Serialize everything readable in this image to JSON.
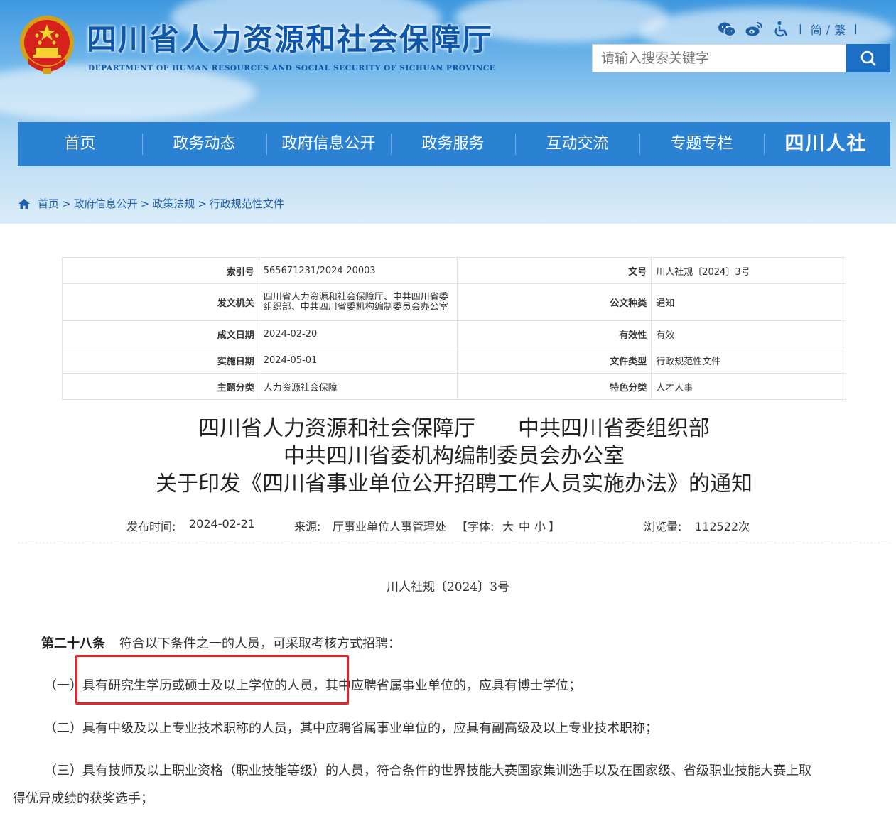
{
  "site": {
    "title": "四川省人力资源和社会保障厅",
    "subtitle": "DEPARTMENT OF HUMAN RESOURCES AND SOCIAL SECURITY OF SICHUAN PROVINCE",
    "tools": {
      "icons": [
        "wechat-icon",
        "weibo-icon",
        "accessibility-icon"
      ],
      "separator": "|",
      "lang_simplified": "简",
      "lang_divider": "/",
      "lang_traditional": "繁"
    },
    "search": {
      "placeholder": "请输入搜索关键字"
    }
  },
  "nav": {
    "items": [
      "首页",
      "政务动态",
      "政府信息公开",
      "政务服务",
      "互动交流",
      "专题专栏"
    ],
    "brand": "四川人社"
  },
  "breadcrumb": {
    "items": [
      "首页",
      "政府信息公开",
      "政策法规",
      "行政规范性文件"
    ],
    "separator": ">"
  },
  "meta": {
    "rows": [
      {
        "label1": "索引号",
        "value1": "565671231/2024-20003",
        "label2": "文号",
        "value2": "川人社规〔2024〕3号"
      },
      {
        "label1": "发文机关",
        "value1": "四川省人力资源和社会保障厅、中共四川省委组织部、中共四川省委机构编制委员会办公室",
        "label2": "公文种类",
        "value2": "通知"
      },
      {
        "label1": "成文日期",
        "value1": "2024-02-20",
        "label2": "有效性",
        "value2": "有效"
      },
      {
        "label1": "实施日期",
        "value1": "2024-05-01",
        "label2": "文件类型",
        "value2": "行政规范性文件"
      },
      {
        "label1": "主题分类",
        "value1": "人力资源社会保障",
        "label2": "特色分类",
        "value2": "人才人事"
      }
    ]
  },
  "doc": {
    "title_line1": "四川省人力资源和社会保障厅　　中共四川省委组织部",
    "title_line2": "中共四川省委机构编制委员会办公室",
    "title_line3": "关于印发《四川省事业单位公开招聘工作人员实施办法》的通知",
    "publish_label": "发布时间:",
    "publish_date": "2024-02-21",
    "source_label": "来源:",
    "source": "厅事业单位人事管理处",
    "font_open": "【字体:",
    "font_large": "大",
    "font_medium": "中",
    "font_small": "小",
    "font_close": "】",
    "views_label": "浏览量:",
    "views": "112522次",
    "doc_number": "川人社规〔2024〕3号"
  },
  "body": {
    "article_heading": "第二十八条",
    "article_text": "符合以下条件之一的人员，可采取考核方式招聘：",
    "item1_prefix": "（一）",
    "item1_highlight": "具有研究生学历或硕士及以上学位的人员，",
    "item1_rest": "其中应聘省属事业单位的，应具有博士学位；",
    "item2": "（二）具有中级及以上专业技术职称的人员，其中应聘省属事业单位的，应具有副高级及以上专业技术职称；",
    "item3_line1": "（三）具有技师及以上职业资格（职业技能等级）的人员，符合条件的世界技能大赛国家集训选手以及在国家级、省级职业技能大赛上取",
    "item3_line2": "得优异成绩的获奖选手；"
  },
  "colors": {
    "nav_bg": "#2b82d2",
    "title_blue": "#0d56a9",
    "highlight_red": "#e3242b"
  }
}
